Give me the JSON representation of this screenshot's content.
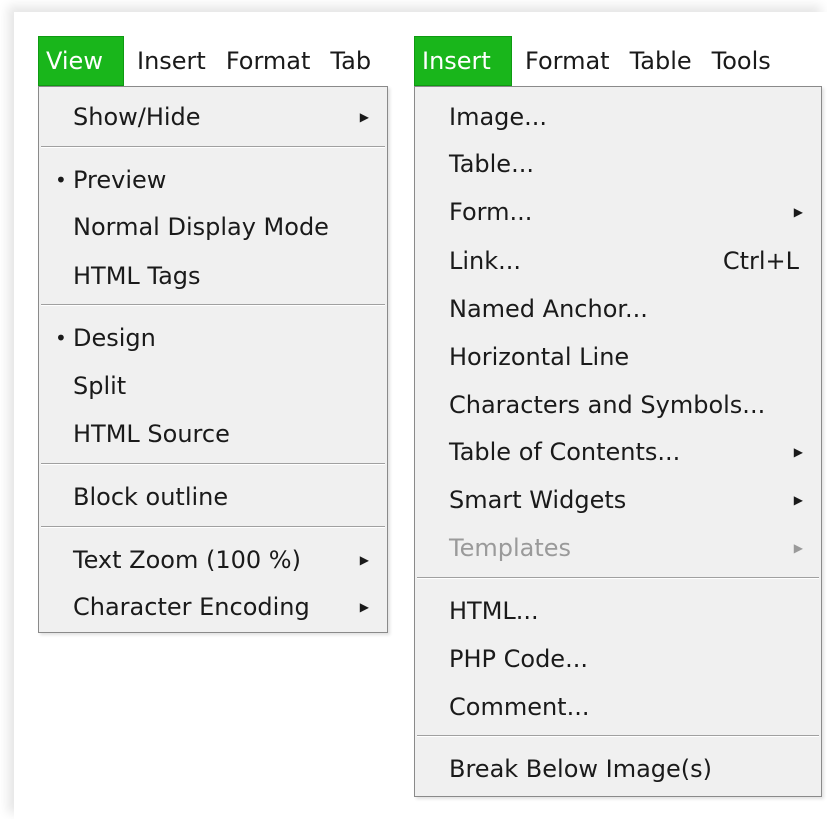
{
  "left_menubar": {
    "items": [
      "View",
      "Insert",
      "Format",
      "Tab"
    ]
  },
  "view_menu": {
    "items": [
      {
        "label": "Show/Hide",
        "submenu": true
      },
      {
        "label": "Preview",
        "checked": true
      },
      {
        "label": "Normal Display Mode"
      },
      {
        "label": "HTML Tags"
      },
      {
        "label": "Design",
        "checked": true
      },
      {
        "label": "Split"
      },
      {
        "label": "HTML Source"
      },
      {
        "label": "Block outline"
      },
      {
        "label": "Text Zoom (100 %)",
        "submenu": true
      },
      {
        "label": "Character Encoding",
        "submenu": true
      }
    ]
  },
  "right_menubar": {
    "items": [
      "Insert",
      "Format",
      "Table",
      "Tools"
    ]
  },
  "insert_menu": {
    "items": [
      {
        "label": "Image..."
      },
      {
        "label": "Table..."
      },
      {
        "label": "Form...",
        "submenu": true
      },
      {
        "label": "Link...",
        "shortcut": "Ctrl+L"
      },
      {
        "label": "Named Anchor..."
      },
      {
        "label": "Horizontal Line"
      },
      {
        "label": "Characters and Symbols..."
      },
      {
        "label": "Table of Contents...",
        "submenu": true
      },
      {
        "label": "Smart Widgets",
        "submenu": true
      },
      {
        "label": "Templates",
        "submenu": true,
        "disabled": true
      },
      {
        "label": "HTML..."
      },
      {
        "label": "PHP Code..."
      },
      {
        "label": "Comment..."
      },
      {
        "label": "Break Below Image(s)"
      }
    ]
  },
  "colors": {
    "accent": "#19b61b",
    "menu_bg": "#f0f0f0",
    "disabled_text": "#9a9a9a"
  }
}
